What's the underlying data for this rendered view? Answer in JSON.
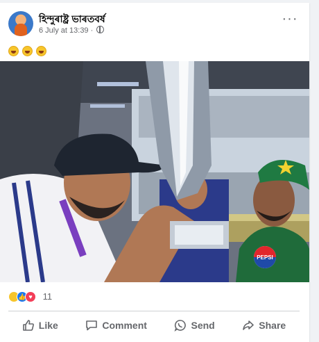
{
  "post": {
    "author": "হিন্দুৰাষ্ট্ৰ ভাৰতবৰ্ষ",
    "timestamp": "6 July at 13:39",
    "separator": "·",
    "privacy_icon": "globe-icon",
    "more_label": "···",
    "caption_emojis": [
      "laugh-emoji",
      "laugh-emoji",
      "laugh-emoji"
    ]
  },
  "image": {
    "jersey_text": "PEPSI",
    "description_icon": "photo"
  },
  "reactions": {
    "types": [
      "haha",
      "like",
      "love"
    ],
    "count": "11"
  },
  "actions": [
    {
      "label": "Like",
      "icon": "thumbs-up-icon"
    },
    {
      "label": "Comment",
      "icon": "comment-icon"
    },
    {
      "label": "Send",
      "icon": "whatsapp-icon"
    },
    {
      "label": "Share",
      "icon": "share-icon"
    }
  ],
  "colors": {
    "text_primary": "#050505",
    "text_secondary": "#65676b",
    "like_blue": "#1877f2",
    "love_red": "#f33e58",
    "haha_yellow": "#f7c52b"
  }
}
